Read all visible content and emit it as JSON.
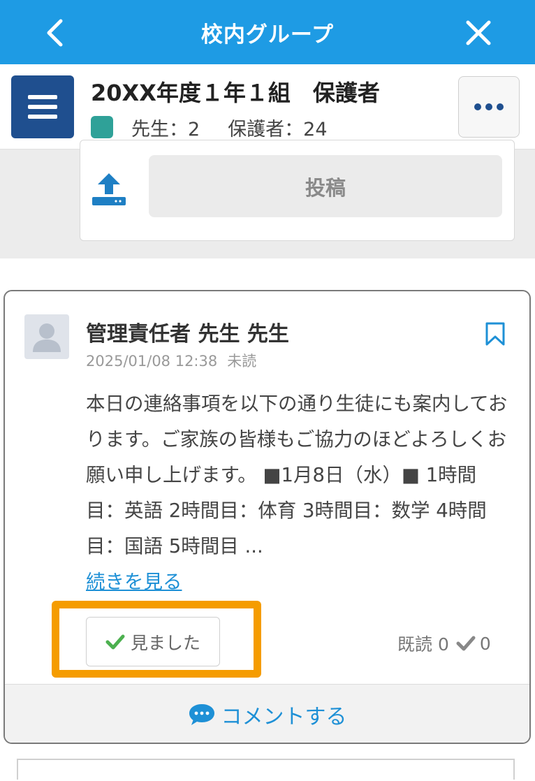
{
  "topbar": {
    "title": "校内グループ",
    "back_icon": "chevron-left-icon",
    "close_icon": "close-icon",
    "color": "#1e9be4"
  },
  "group": {
    "name": "20XX年度１年１組　保護者",
    "teacher_count": "先生：2",
    "guardian_count": "保護者：24",
    "badge_color": "#2fa198",
    "menu_icon": "hamburger-menu-icon",
    "more_icon": "more-dots-icon"
  },
  "composer": {
    "upload_icon": "upload-icon",
    "post_label": "投稿"
  },
  "post": {
    "author": "管理責任者 先生 先生",
    "date": "2025/01/08 12:38",
    "status": "未読",
    "body": "本日の連絡事項を以下の通り生徒にも案内しております。ご家族の皆様もご協力のほどよろしくお願い申し上げます。 ■1月8日（水）■ 1時間目：英語 2時間目：体育 3時間目：数学 4時間目：国語 5時間目 ...",
    "read_more": "続きを見る",
    "seen_label": "見ました",
    "read_label": "既読 0",
    "check_count": "0",
    "comment_label": "コメントする",
    "highlight_color": "#f59c00",
    "link_color": "#1e90d6"
  }
}
